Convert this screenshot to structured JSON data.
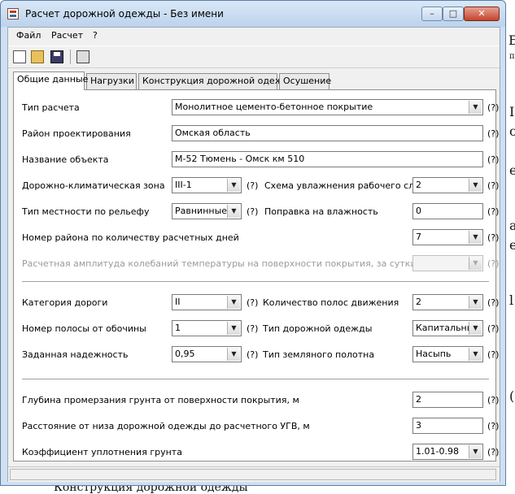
{
  "window": {
    "title": "Расчет дорожной одежды - Без имени",
    "min": "–",
    "max": "□",
    "close": "✕"
  },
  "menu": [
    "Файл",
    "Расчет",
    "?"
  ],
  "toolbar": {
    "icons": [
      "new-file-icon",
      "open-folder-icon",
      "save-disk-icon",
      "calculator-icon"
    ]
  },
  "tabs": [
    "Общие данные",
    "Нагрузки",
    "Конструкция дорожной одежды",
    "Осушение"
  ],
  "hint_mark": "(?)",
  "fields": {
    "calc_type": {
      "label": "Тип расчета",
      "value": "Монолитное цементо-бетонное покрытие"
    },
    "region": {
      "label": "Район проектирования",
      "value": "Омская область"
    },
    "object_name": {
      "label": "Название объекта",
      "value": "М-52 Тюмень - Омск км 510"
    },
    "climate_zone": {
      "label": "Дорожно-климатическая зона",
      "value": "III-1"
    },
    "moisture_scheme": {
      "label": "Схема увлажнения рабочего слоя",
      "value": "2"
    },
    "terrain_type": {
      "label": "Тип местности по рельефу",
      "value": "Равнинные р"
    },
    "moisture_correction": {
      "label": "Поправка на влажность",
      "value": "0"
    },
    "calc_days_region": {
      "label": "Номер района по количеству расчетных дней",
      "value": "7"
    },
    "temp_amplitude": {
      "label": "Расчетная амплитуда колебаний температуры на поверхности покрытия, за сутки",
      "value": ""
    },
    "road_category": {
      "label": "Категория дороги",
      "value": "II"
    },
    "lanes_count": {
      "label": "Количество полос движения",
      "value": "2"
    },
    "lane_number": {
      "label": "Номер полосы от обочины",
      "value": "1"
    },
    "pavement_type": {
      "label": "Тип дорожной одежды",
      "value": "Капитальный"
    },
    "reliability": {
      "label": "Заданная надежность",
      "value": "0,95"
    },
    "subgrade_type": {
      "label": "Тип земляного полотна",
      "value": "Насыпь"
    },
    "freeze_depth": {
      "label": "Глубина промерзания грунта от поверхности покрытия, м",
      "value": "2"
    },
    "groundwater_distance": {
      "label": "Расстояние от низа дорожной одежды до расчетного УГВ, м",
      "value": "3"
    },
    "compaction_coef": {
      "label": "Коэффициент уплотнения грунта",
      "value": "1.01-0.98"
    }
  },
  "background_text": [
    "Б",
    "п",
    "I",
    "с",
    "е",
    "а",
    "е",
    "l",
    "(",
    "Конструкция дорожной одежды"
  ]
}
